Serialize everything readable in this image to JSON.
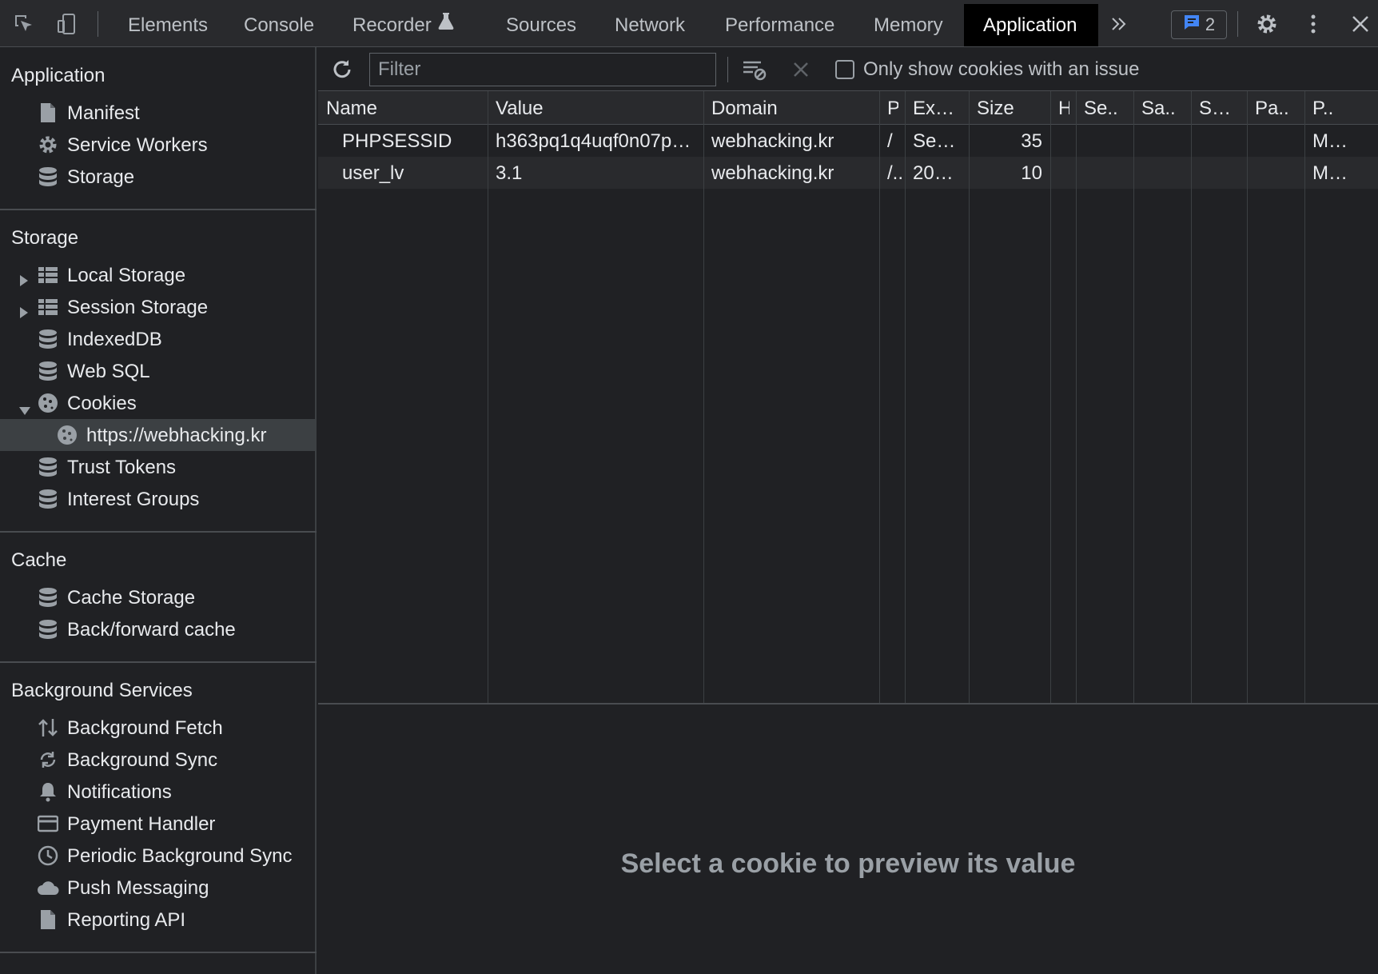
{
  "toolbar": {
    "tabs": [
      "Elements",
      "Console",
      "Recorder",
      "Sources",
      "Network",
      "Performance",
      "Memory",
      "Application"
    ],
    "active_tab": "Application",
    "issues_count": "2"
  },
  "sidebar": {
    "sections": {
      "application": {
        "title": "Application",
        "items": [
          "Manifest",
          "Service Workers",
          "Storage"
        ]
      },
      "storage": {
        "title": "Storage",
        "items": [
          "Local Storage",
          "Session Storage",
          "IndexedDB",
          "Web SQL",
          "Cookies",
          "https://webhacking.kr",
          "Trust Tokens",
          "Interest Groups"
        ]
      },
      "cache": {
        "title": "Cache",
        "items": [
          "Cache Storage",
          "Back/forward cache"
        ]
      },
      "background": {
        "title": "Background Services",
        "items": [
          "Background Fetch",
          "Background Sync",
          "Notifications",
          "Payment Handler",
          "Periodic Background Sync",
          "Push Messaging",
          "Reporting API"
        ]
      }
    }
  },
  "filterbar": {
    "placeholder": "Filter",
    "only_issue_label": "Only show cookies with an issue"
  },
  "cookies_table": {
    "columns": [
      "Name",
      "Value",
      "Domain",
      "P",
      "Ex…",
      "Size",
      "H",
      "Se..",
      "Sa..",
      "S…",
      "Pa..",
      "P.."
    ],
    "rows": [
      {
        "name": "PHPSESSID",
        "value": "h363pq1q4uqf0n07p…",
        "domain": "webhacking.kr",
        "path": "/",
        "expires": "Se…",
        "size": "35",
        "priority": "M…"
      },
      {
        "name": "user_lv",
        "value": "3.1",
        "domain": "webhacking.kr",
        "path": "/..",
        "expires": "20…",
        "size": "10",
        "priority": "M…"
      }
    ]
  },
  "preview": {
    "message": "Select a cookie to preview its value"
  },
  "colors": {
    "background": "#202124",
    "toolbar": "#292a2d",
    "active_tab": "#000000",
    "selected_item": "#3c4043",
    "issue_accent": "#4285f4"
  }
}
